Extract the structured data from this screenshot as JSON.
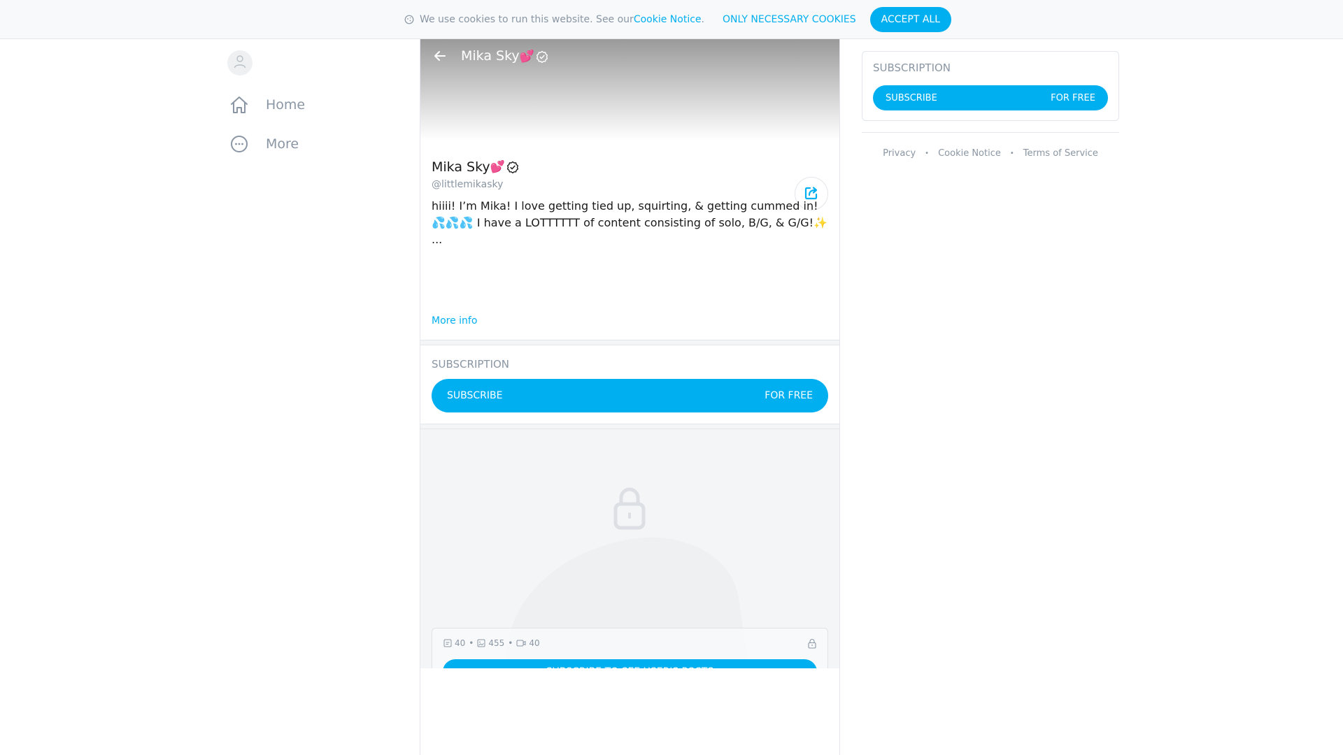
{
  "cookie_bar": {
    "text": "We use cookies to run this website. See our ",
    "link_label": "Cookie Notice",
    "period": ".",
    "necessary_label": "ONLY NECESSARY COOKIES",
    "accept_label": "ACCEPT ALL"
  },
  "sidebar": {
    "items": [
      {
        "label": "Home",
        "icon": "home-icon"
      },
      {
        "label": "More",
        "icon": "more-icon"
      }
    ]
  },
  "profile": {
    "header_name": "Mika Sky",
    "name": "Mika Sky",
    "name_emoji": "💕",
    "handle": "@littlemikasky",
    "bio_line1": "hiiii! I’m Mika! I love getting tied up, squirting, & getting cummed in!",
    "bio_line2_emoji": "💦💦💦",
    "bio_line2": " I have a LOTTTTTT of content consisting of solo, B/G, & G/G!",
    "bio_line2_end_emoji": "✨",
    "bio_ellipsis": "...",
    "more_info_label": "More info"
  },
  "subscription": {
    "label": "SUBSCRIPTION",
    "button_left": "SUBSCRIBE",
    "button_right": "FOR FREE"
  },
  "locked": {
    "posts_count": "40",
    "photos_count": "455",
    "videos_count": "40",
    "separator": "•",
    "button_label": "SUBSCRIBE TO SEE USER'S POSTS"
  },
  "right_panel": {
    "label": "SUBSCRIPTION",
    "button_left": "SUBSCRIBE",
    "button_right": "FOR FREE",
    "footer_links": [
      "Privacy",
      "Cookie Notice",
      "Terms of Service"
    ],
    "footer_separator": "•"
  },
  "colors": {
    "accent": "#00aff0",
    "muted_text": "#8a96a3",
    "border": "#e3e6ea"
  }
}
